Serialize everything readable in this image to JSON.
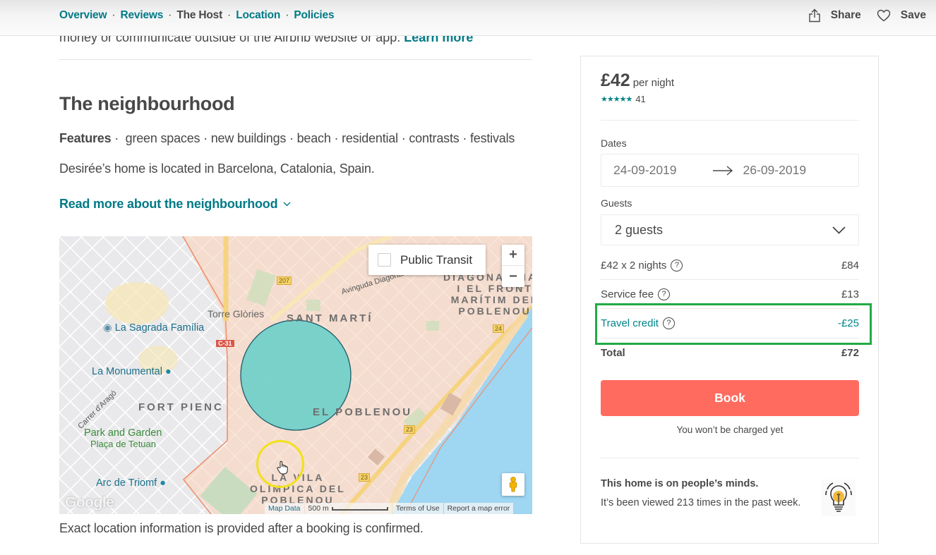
{
  "nav": {
    "links": [
      {
        "label": "Overview",
        "current": false
      },
      {
        "label": "Reviews",
        "current": false
      },
      {
        "label": "The Host",
        "current": true
      },
      {
        "label": "Location",
        "current": false
      },
      {
        "label": "Policies",
        "current": false
      }
    ],
    "separator": "·",
    "share_label": "Share",
    "save_label": "Save",
    "share_icon": "share-icon",
    "save_icon": "heart-icon"
  },
  "clipped_text": {
    "text": "money or communicate outside of the Airbnb website or app.",
    "link": "Learn more"
  },
  "neighbourhood": {
    "title": "The neighbourhood",
    "features_label": "Features",
    "features": [
      "green spaces",
      "new buildings",
      "beach",
      "residential",
      "contrasts",
      "festivals"
    ],
    "description": "Desirée’s home is located in Barcelona, Catalonia, Spain.",
    "read_more": "Read more about the neighbourhood",
    "exact_location_note": "Exact location information is provided after a booking is confirmed."
  },
  "map": {
    "public_transit_label": "Public Transit",
    "public_transit_checked": false,
    "zoom_in": "+",
    "zoom_out": "−",
    "districts": [
      {
        "name": "SANT MARTÍ"
      },
      {
        "name": "FORT PIENC"
      },
      {
        "name": "EL POBLENOU"
      },
      {
        "name": "DIAGONAL MAR\nI EL FRONT\nMARÍTIM DEL\nPOBLENOU"
      },
      {
        "name": "LA VILA\nOLÍMPICA DEL\nPOBLENOU"
      }
    ],
    "pois": [
      "La Sagrada Família",
      "La Monumental",
      "Arc de Triomf",
      "Torre Glòries"
    ],
    "parks": [
      "Park and Garden",
      "Plaça de Tetuan"
    ],
    "roads": [
      "Avinguda Diagonal",
      "Carrer d'Aragó"
    ],
    "road_shields": [
      "207",
      "C-31",
      "24",
      "23",
      "23"
    ],
    "footer": {
      "logo": "Google",
      "map_data": "Map Data",
      "scale": "500 m",
      "terms": "Terms of Use",
      "report": "Report a map error"
    },
    "colors": {
      "circle_fill": "#6ccfca",
      "circle_stroke": "#1e5a6a",
      "water": "#9fd6f2",
      "district_tint": "#f6d9c9"
    }
  },
  "booking": {
    "price": "£42",
    "per_night": "per night",
    "stars": "★★★★★",
    "rating_value": 5,
    "review_count": "41",
    "dates_label": "Dates",
    "check_in": "24-09-2019",
    "check_out": "26-09-2019",
    "guests_label": "Guests",
    "guests_value": "2 guests",
    "lines": [
      {
        "label": "£42 x 2 nights",
        "value": "£84",
        "help": true
      },
      {
        "label": "Service fee",
        "value": "£13",
        "help": true
      },
      {
        "label": "Travel credit",
        "value": "-£25",
        "help": true
      },
      {
        "label": "Total",
        "value": "£72",
        "help": false
      }
    ],
    "book_label": "Book",
    "charge_note": "You won’t be charged yet",
    "minds_title": "This home is on people’s minds.",
    "minds_text": "It’s been viewed 213 times in the past week.",
    "colors": {
      "accent": "#008489",
      "book_button": "#ff6b5f",
      "highlight_border": "#22aa44"
    }
  }
}
